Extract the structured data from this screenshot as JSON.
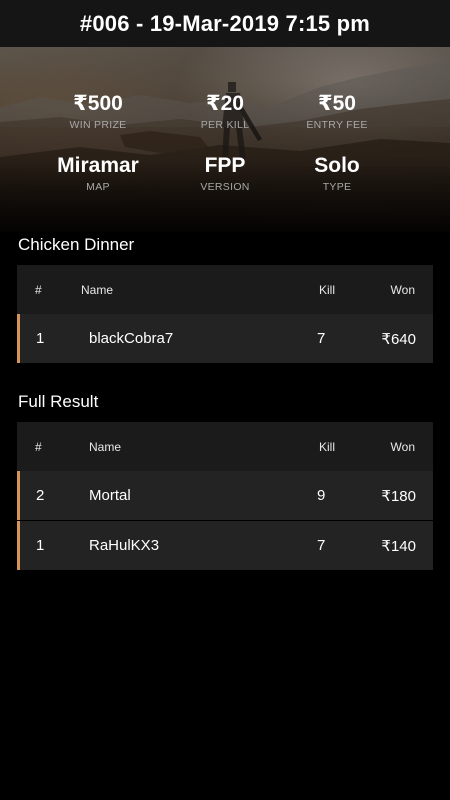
{
  "header": {
    "title": "#006 - 19-Mar-2019 7:15 pm"
  },
  "match_info": {
    "win_prize": {
      "value": "₹500",
      "label": "WIN PRIZE"
    },
    "per_kill": {
      "value": "₹20",
      "label": "PER KILL"
    },
    "entry_fee": {
      "value": "₹50",
      "label": "ENTRY FEE"
    },
    "map": {
      "value": "Miramar",
      "label": "MAP"
    },
    "version": {
      "value": "FPP",
      "label": "VERSION"
    },
    "type": {
      "value": "Solo",
      "label": "TYPE"
    }
  },
  "chicken_dinner": {
    "title": "Chicken Dinner",
    "columns": {
      "num": "#",
      "name": "Name",
      "kill": "Kill",
      "won": "Won"
    },
    "rows": [
      {
        "num": "1",
        "name": "blackCobra7",
        "kill": "7",
        "won": "₹640"
      }
    ]
  },
  "full_result": {
    "title": "Full Result",
    "columns": {
      "num": "#",
      "name": "Name",
      "kill": "Kill",
      "won": "Won"
    },
    "rows": [
      {
        "num": "2",
        "name": "Mortal",
        "kill": "9",
        "won": "₹180"
      },
      {
        "num": "1",
        "name": "RaHulKX3",
        "kill": "7",
        "won": "₹140"
      }
    ]
  },
  "colors": {
    "accent": "#d4935a",
    "header_bg": "#151515",
    "row_bg": "#232323",
    "thead_bg": "#1b1b1b"
  }
}
